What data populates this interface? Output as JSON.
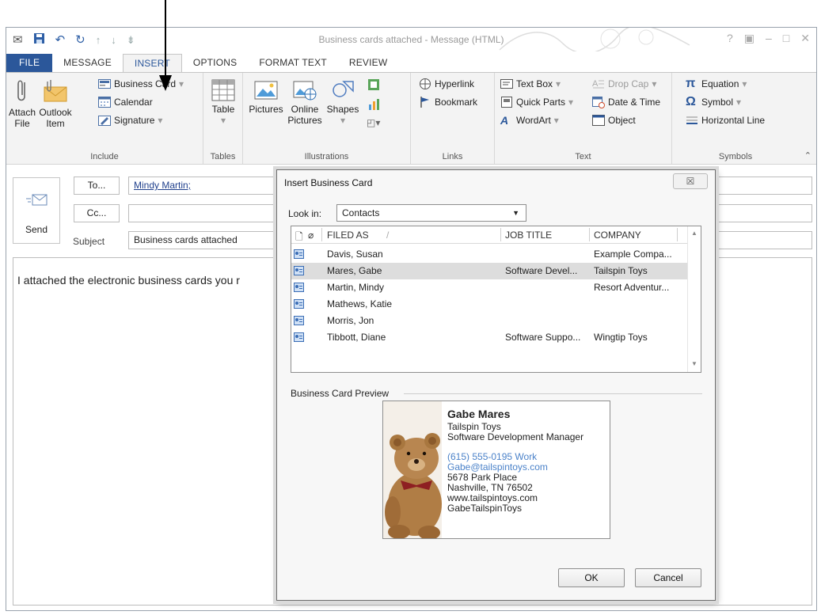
{
  "window": {
    "title": "Business cards attached - Message (HTML)",
    "controls": [
      "?",
      "▣",
      "–",
      "□",
      "✕"
    ]
  },
  "qat": {
    "icons": [
      "mail-icon",
      "save-icon",
      "undo-icon",
      "redo-icon",
      "up-arrow-icon",
      "down-arrow-icon",
      "customize-icon"
    ]
  },
  "tabs": [
    "FILE",
    "MESSAGE",
    "INSERT",
    "OPTIONS",
    "FORMAT TEXT",
    "REVIEW"
  ],
  "active_tab": "INSERT",
  "ribbon": {
    "include": {
      "label": "Include",
      "attach_file": [
        "Attach",
        "File"
      ],
      "outlook_item": [
        "Outlook",
        "Item"
      ],
      "business_card": "Business Card",
      "calendar": "Calendar",
      "signature": "Signature"
    },
    "tables": {
      "label": "Tables",
      "table": "Table"
    },
    "illustrations": {
      "label": "Illustrations",
      "pictures": "Pictures",
      "online_pictures": [
        "Online",
        "Pictures"
      ],
      "shapes": "Shapes"
    },
    "links": {
      "label": "Links",
      "hyperlink": "Hyperlink",
      "bookmark": "Bookmark"
    },
    "text": {
      "label": "Text",
      "text_box": "Text Box",
      "quick_parts": "Quick Parts",
      "wordart": "WordArt",
      "drop_cap": "Drop Cap",
      "date_time": "Date & Time",
      "object": "Object"
    },
    "symbols": {
      "label": "Symbols",
      "equation": "Equation",
      "symbol": "Symbol",
      "horizontal_line": "Horizontal Line"
    }
  },
  "compose": {
    "send": "Send",
    "to_button": "To...",
    "to_value": "Mindy Martin;",
    "cc_button": "Cc...",
    "cc_value": "",
    "subject_label": "Subject",
    "subject_value": "Business cards attached",
    "body": "I attached the electronic business cards you r"
  },
  "dialog": {
    "title": "Insert Business Card",
    "close": "☒",
    "look_in_label": "Look in:",
    "look_in_value": "Contacts",
    "columns": [
      "FILED AS",
      "JOB TITLE",
      "COMPANY"
    ],
    "rows": [
      {
        "filed_as": "Davis, Susan",
        "job_title": "",
        "company": "Example Compa..."
      },
      {
        "filed_as": "Mares, Gabe",
        "job_title": "Software Devel...",
        "company": "Tailspin Toys"
      },
      {
        "filed_as": "Martin, Mindy",
        "job_title": "",
        "company": "Resort Adventur..."
      },
      {
        "filed_as": "Mathews, Katie",
        "job_title": "",
        "company": ""
      },
      {
        "filed_as": "Morris, Jon",
        "job_title": "",
        "company": ""
      },
      {
        "filed_as": "Tibbott, Diane",
        "job_title": "Software Suppo...",
        "company": "Wingtip Toys"
      }
    ],
    "selected_row": "Mares, Gabe",
    "preview_label": "Business Card Preview",
    "card": {
      "name": "Gabe Mares",
      "company": "Tailspin Toys",
      "title": "Software Development Manager",
      "phone": "(615) 555-0195",
      "phone_type": "Work",
      "email": "Gabe@tailspintoys.com",
      "address1": "5678 Park Place",
      "address2": "Nashville, TN 76502",
      "web": "www.tailspintoys.com",
      "im": "GabeTailspinToys"
    },
    "ok": "OK",
    "cancel": "Cancel"
  }
}
